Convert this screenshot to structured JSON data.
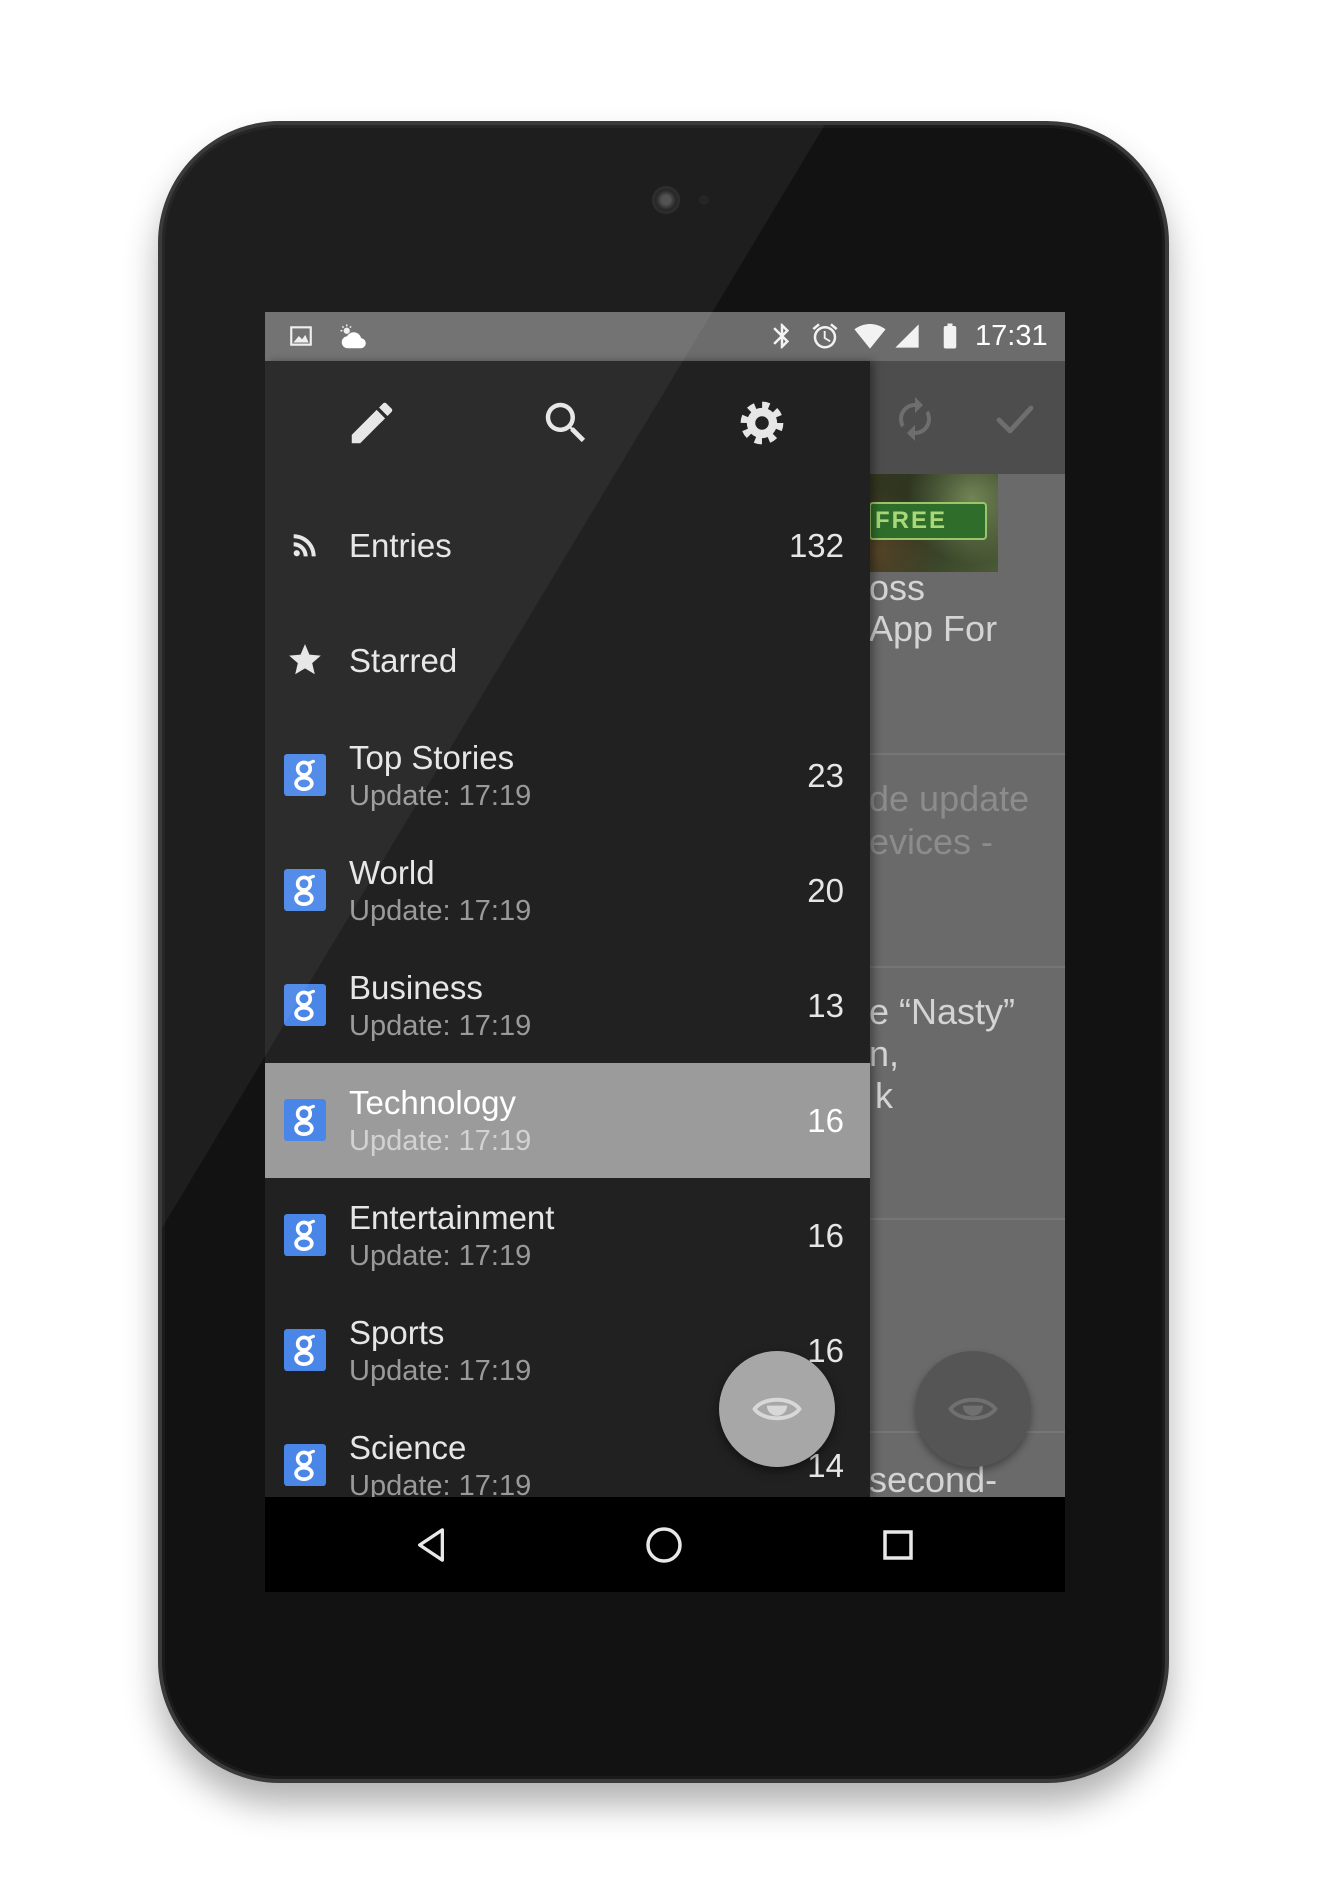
{
  "status_bar": {
    "time": "17:31",
    "left_icons": [
      "gallery-icon",
      "weather-cloudy-icon"
    ],
    "right_icons": [
      "bluetooth-icon",
      "alarm-icon",
      "wifi-icon",
      "cell-signal-icon",
      "battery-icon"
    ]
  },
  "drawer": {
    "toolbar": [
      {
        "icon": "pencil-icon"
      },
      {
        "icon": "search-icon"
      },
      {
        "icon": "gear-icon"
      }
    ],
    "items": [
      {
        "label": "Entries",
        "count": "132",
        "icon": "rss-icon"
      },
      {
        "label": "Starred",
        "icon": "star-icon"
      },
      {
        "label": "Top Stories",
        "subtitle": "Update: 17:19",
        "count": "23",
        "icon": "google-news-icon"
      },
      {
        "label": "World",
        "subtitle": "Update: 17:19",
        "count": "20",
        "icon": "google-news-icon"
      },
      {
        "label": "Business",
        "subtitle": "Update: 17:19",
        "count": "13",
        "icon": "google-news-icon"
      },
      {
        "label": "Technology",
        "subtitle": "Update: 17:19",
        "count": "16",
        "icon": "google-news-icon",
        "selected": true
      },
      {
        "label": "Entertainment",
        "subtitle": "Update: 17:19",
        "count": "16",
        "icon": "google-news-icon"
      },
      {
        "label": "Sports",
        "subtitle": "Update: 17:19",
        "count": "16",
        "icon": "google-news-icon"
      },
      {
        "label": "Science",
        "subtitle": "Update: 17:19",
        "count": "14",
        "icon": "google-news-icon"
      }
    ],
    "fab_icon": "eye-icon"
  },
  "background_feed": {
    "toolbar_icons": [
      "refresh-icon",
      "check-icon"
    ],
    "articles": [
      {
        "thumbnail_text": "FREE",
        "title_lines": [
          "oss",
          "App For"
        ]
      },
      {
        "title_lines": [
          "de update",
          "evices -"
        ],
        "read": true
      },
      {
        "title_lines": [
          "e “Nasty”",
          "n,",
          "k"
        ]
      },
      {
        "title_lines": [
          "second-"
        ]
      }
    ],
    "fab_icon": "eye-icon"
  },
  "nav_bar": {
    "icons": [
      "back-icon",
      "home-icon",
      "recents-icon"
    ]
  },
  "colors": {
    "drawer_background": "#212121",
    "selected_row": "#9b9b9b",
    "status_bar": "#6c6c6c",
    "google_news_blue": "#4a86e8"
  }
}
